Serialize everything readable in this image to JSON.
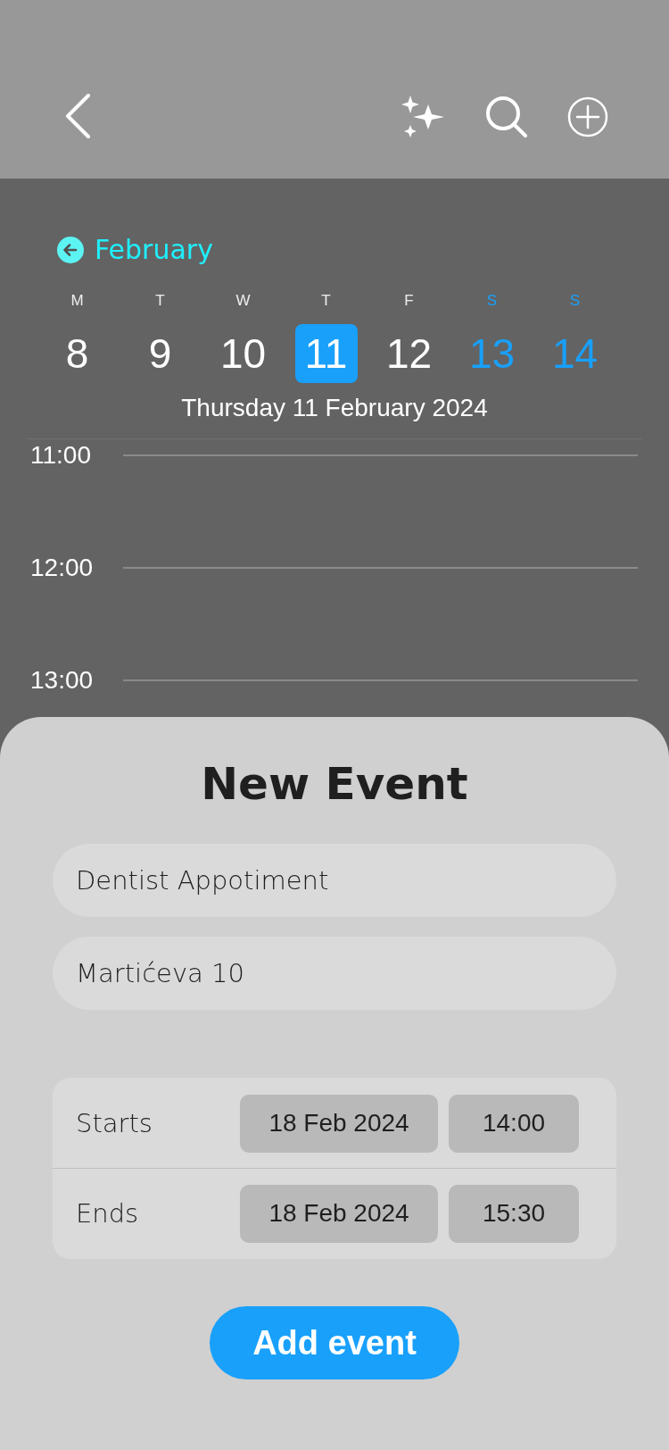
{
  "toolbar": {
    "actions": [
      {
        "kind": "sparkles"
      },
      {
        "kind": "search"
      },
      {
        "kind": "add"
      }
    ]
  },
  "month": {
    "label": "February"
  },
  "days": [
    {
      "letter": "M",
      "number": "8",
      "selected": false,
      "weekend": false
    },
    {
      "letter": "T",
      "number": "9",
      "selected": false,
      "weekend": false
    },
    {
      "letter": "W",
      "number": "10",
      "selected": false,
      "weekend": false
    },
    {
      "letter": "T",
      "number": "11",
      "selected": true,
      "weekend": false
    },
    {
      "letter": "F",
      "number": "12",
      "selected": false,
      "weekend": false
    },
    {
      "letter": "S",
      "number": "13",
      "selected": false,
      "weekend": true
    },
    {
      "letter": "S",
      "number": "14",
      "selected": false,
      "weekend": true
    }
  ],
  "date_title": "Thursday 11 February 2024",
  "hours": [
    "11:00",
    "12:00",
    "13:00"
  ],
  "sheet": {
    "title": "New Event",
    "fields": [
      {
        "value": "Dentist Appotiment"
      },
      {
        "value": "Martićeva 10"
      }
    ],
    "times": [
      {
        "label": "Starts",
        "date": "18 Feb 2024",
        "time": "14:00"
      },
      {
        "label": "Ends",
        "date": "18 Feb 2024",
        "time": "15:30"
      }
    ],
    "button": "Add event"
  }
}
